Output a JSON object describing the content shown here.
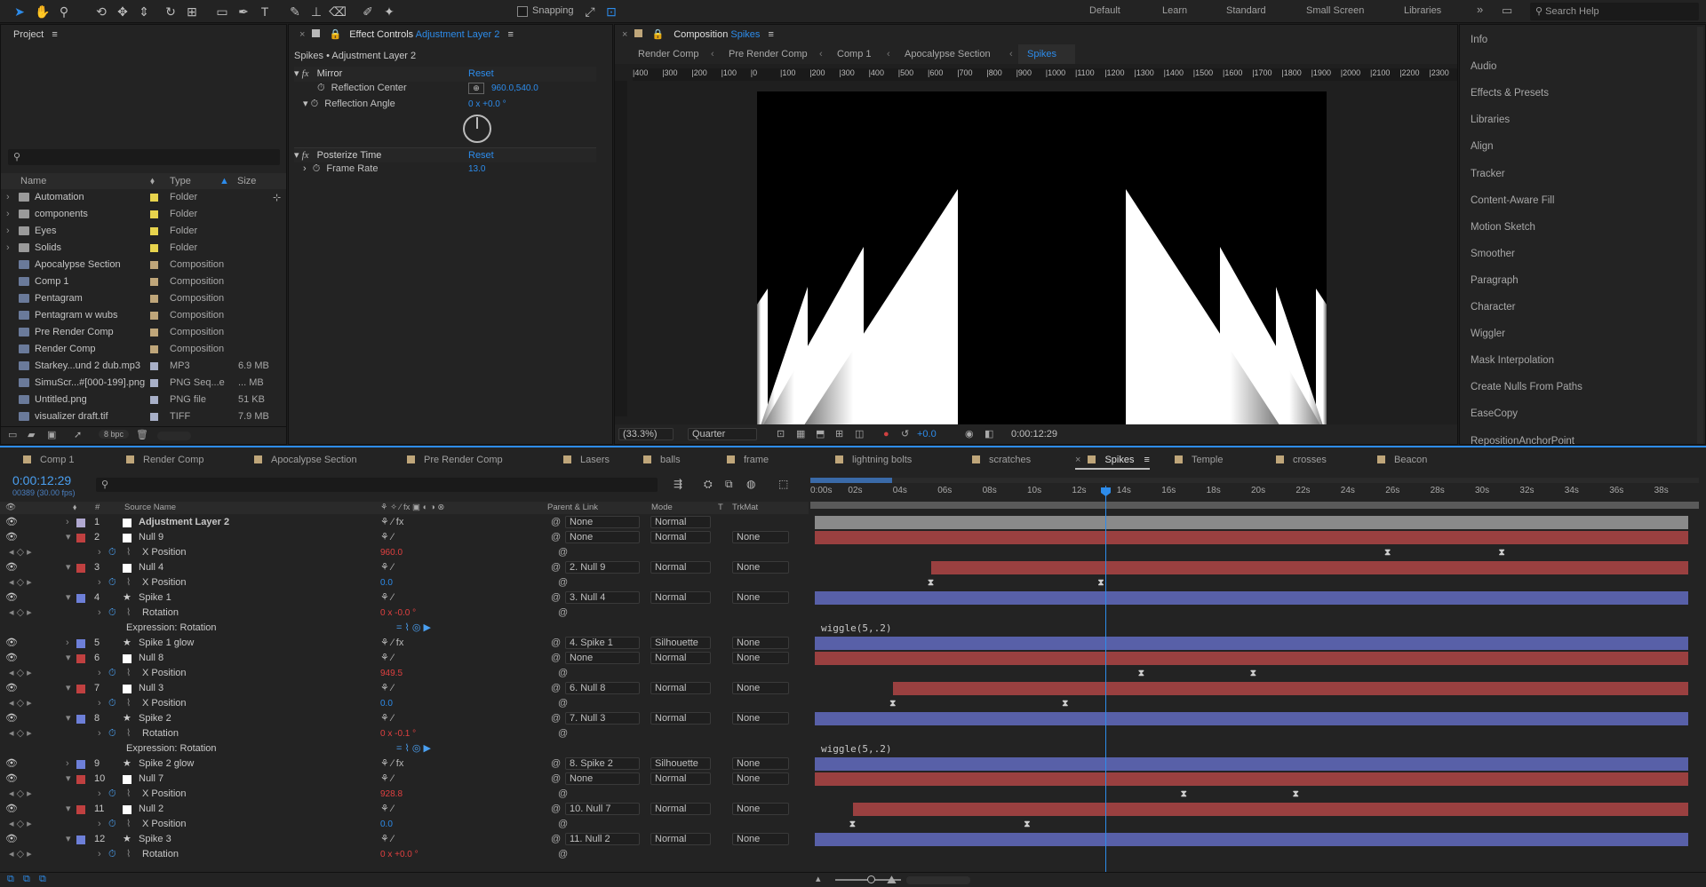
{
  "toolbar": {
    "snapping": "Snapping",
    "workspaces": [
      "Default",
      "Learn",
      "Standard",
      "Small Screen",
      "Libraries"
    ],
    "search_placeholder": "Search Help"
  },
  "project": {
    "title": "Project",
    "columns": {
      "name": "Name",
      "type": "Type",
      "size": "Size"
    },
    "items": [
      {
        "name": "Automation",
        "type": "Folder",
        "size": "",
        "color": "#e8d44d"
      },
      {
        "name": "components",
        "type": "Folder",
        "size": "",
        "color": "#e8d44d"
      },
      {
        "name": "Eyes",
        "type": "Folder",
        "size": "",
        "color": "#e8d44d"
      },
      {
        "name": "Solids",
        "type": "Folder",
        "size": "",
        "color": "#e8d44d"
      },
      {
        "name": "Apocalypse Section",
        "type": "Composition",
        "size": "",
        "color": "#bfa67a"
      },
      {
        "name": "Comp 1",
        "type": "Composition",
        "size": "",
        "color": "#bfa67a"
      },
      {
        "name": "Pentagram",
        "type": "Composition",
        "size": "",
        "color": "#bfa67a"
      },
      {
        "name": "Pentagram w wubs",
        "type": "Composition",
        "size": "",
        "color": "#bfa67a"
      },
      {
        "name": "Pre Render Comp",
        "type": "Composition",
        "size": "",
        "color": "#bfa67a"
      },
      {
        "name": "Render Comp",
        "type": "Composition",
        "size": "",
        "color": "#bfa67a"
      },
      {
        "name": "Starkey...und 2 dub.mp3",
        "type": "MP3",
        "size": "6.9 MB",
        "color": "#a8b0c8"
      },
      {
        "name": "SimuScr...#[000-199].png",
        "type": "PNG Seq...e",
        "size": "... MB",
        "color": "#a8b0c8"
      },
      {
        "name": "Untitled.png",
        "type": "PNG file",
        "size": "51 KB",
        "color": "#a8b0c8"
      },
      {
        "name": "visualizer draft.tif",
        "type": "TIFF",
        "size": "7.9 MB",
        "color": "#a8b0c8"
      }
    ],
    "bpc": "8 bpc"
  },
  "effect_controls": {
    "title": "Effect Controls",
    "layer": "Adjustment Layer 2",
    "breadcrumb": "Spikes • Adjustment Layer 2",
    "mirror": {
      "name": "Mirror",
      "reset": "Reset",
      "center_label": "Reflection Center",
      "center_value": "960.0,540.0",
      "angle_label": "Reflection Angle",
      "angle_value": "0 x +0.0 °"
    },
    "posterize": {
      "name": "Posterize Time",
      "reset": "Reset",
      "rate_label": "Frame Rate",
      "rate_value": "13.0"
    }
  },
  "composition": {
    "title": "Composition",
    "name": "Spikes",
    "breadcrumbs": [
      "Render Comp",
      "Pre Render Comp",
      "Comp 1",
      "Apocalypse Section",
      "Spikes"
    ],
    "zoom": "(33.3%)",
    "resolution": "Quarter",
    "exposure": "+0.0",
    "timecode": "0:00:12:29",
    "ruler": [
      "|400",
      "|300",
      "|200",
      "|100",
      "|0",
      "|100",
      "|200",
      "|300",
      "|400",
      "|500",
      "|600",
      "|700",
      "|800",
      "|900",
      "|1000",
      "|1100",
      "|1200",
      "|1300",
      "|1400",
      "|1500",
      "|1600",
      "|1700",
      "|1800",
      "|1900",
      "|2000",
      "|2100",
      "|2200",
      "|2300"
    ]
  },
  "right_panel": [
    "Info",
    "Audio",
    "Effects & Presets",
    "Libraries",
    "Align",
    "Tracker",
    "Content-Aware Fill",
    "Motion Sketch",
    "Smoother",
    "Paragraph",
    "Character",
    "Wiggler",
    "Mask Interpolation",
    "Create Nulls From Paths",
    "EaseCopy",
    "RepositionAnchorPoint"
  ],
  "timeline": {
    "tabs": [
      "Comp 1",
      "Render Comp",
      "Apocalypse Section",
      "Pre Render Comp",
      "Lasers",
      "balls",
      "frame",
      "lightning bolts",
      "scratches",
      "Spikes",
      "Temple",
      "crosses",
      "Beacon"
    ],
    "active_tab": "Spikes",
    "timecode": "0:00:12:29",
    "frame_info": "00389 (30.00 fps)",
    "col_headers": {
      "num": "#",
      "source": "Source Name",
      "parent": "Parent & Link",
      "mode": "Mode",
      "t": "T",
      "trkmat": "TrkMat"
    },
    "ruler": [
      "0:00s",
      "02s",
      "04s",
      "06s",
      "08s",
      "10s",
      "12s",
      "14s",
      "16s",
      "18s",
      "20s",
      "22s",
      "24s",
      "26s",
      "28s",
      "30s",
      "32s",
      "34s",
      "36s",
      "38s"
    ],
    "rows": [
      {
        "kind": "layer",
        "num": "1",
        "name": "Adjustment Layer 2",
        "color": "#b0a8d0",
        "parent": "None",
        "mode": "Normal",
        "trkmat": "",
        "bar": "#8a8a8a",
        "bold": true
      },
      {
        "kind": "layer",
        "num": "2",
        "name": "Null 9",
        "color": "#c04040",
        "parent": "None",
        "mode": "Normal",
        "trkmat": "None",
        "bar": "#9a4040"
      },
      {
        "kind": "prop",
        "name": "X Position",
        "value": "960.0",
        "valcolor": "red",
        "kfs": [
          25.6,
          30.7
        ]
      },
      {
        "kind": "layer",
        "num": "3",
        "name": "Null 4",
        "color": "#c04040",
        "parent": "2. Null 9",
        "mode": "Normal",
        "trkmat": "None",
        "bar": "#9a4040",
        "barstart": 5.2
      },
      {
        "kind": "prop",
        "name": "X Position",
        "value": "0.0",
        "valcolor": "blue",
        "kfs": [
          5.2,
          12.8
        ]
      },
      {
        "kind": "layer",
        "num": "4",
        "name": "Spike 1",
        "color": "#6d7fd8",
        "parent": "3. Null 4",
        "mode": "Normal",
        "trkmat": "None",
        "bar": "#5860a8",
        "star": true
      },
      {
        "kind": "prop",
        "name": "Rotation",
        "value": "0 x -0.0 °",
        "valcolor": "red",
        "kfs": []
      },
      {
        "kind": "expr",
        "name": "Expression: Rotation",
        "expr": "wiggle(5,.2)"
      },
      {
        "kind": "layer",
        "num": "5",
        "name": "Spike 1 glow",
        "color": "#6d7fd8",
        "parent": "4. Spike 1",
        "mode": "Silhouette",
        "trkmat": "None",
        "bar": "#5860a8",
        "star": true
      },
      {
        "kind": "layer",
        "num": "6",
        "name": "Null 8",
        "color": "#c04040",
        "parent": "None",
        "mode": "Normal",
        "trkmat": "None",
        "bar": "#9a4040"
      },
      {
        "kind": "prop",
        "name": "X Position",
        "value": "949.5",
        "valcolor": "red",
        "kfs": [
          14.6,
          19.6
        ]
      },
      {
        "kind": "layer",
        "num": "7",
        "name": "Null 3",
        "color": "#c04040",
        "parent": "6. Null 8",
        "mode": "Normal",
        "trkmat": "None",
        "bar": "#9a4040",
        "barstart": 3.5
      },
      {
        "kind": "prop",
        "name": "X Position",
        "value": "0.0",
        "valcolor": "blue",
        "kfs": [
          3.5,
          11.2
        ]
      },
      {
        "kind": "layer",
        "num": "8",
        "name": "Spike 2",
        "color": "#6d7fd8",
        "parent": "7. Null 3",
        "mode": "Normal",
        "trkmat": "None",
        "bar": "#5860a8",
        "star": true
      },
      {
        "kind": "prop",
        "name": "Rotation",
        "value": "0 x -0.1 °",
        "valcolor": "red",
        "kfs": []
      },
      {
        "kind": "expr",
        "name": "Expression: Rotation",
        "expr": "wiggle(5,.2)"
      },
      {
        "kind": "layer",
        "num": "9",
        "name": "Spike 2 glow",
        "color": "#6d7fd8",
        "parent": "8. Spike 2",
        "mode": "Silhouette",
        "trkmat": "None",
        "bar": "#5860a8",
        "star": true
      },
      {
        "kind": "layer",
        "num": "10",
        "name": "Null 7",
        "color": "#c04040",
        "parent": "None",
        "mode": "Normal",
        "trkmat": "None",
        "bar": "#9a4040"
      },
      {
        "kind": "prop",
        "name": "X Position",
        "value": "928.8",
        "valcolor": "red",
        "kfs": [
          16.5,
          21.5
        ]
      },
      {
        "kind": "layer",
        "num": "11",
        "name": "Null 2",
        "color": "#c04040",
        "parent": "10. Null 7",
        "mode": "Normal",
        "trkmat": "None",
        "bar": "#9a4040",
        "barstart": 1.7
      },
      {
        "kind": "prop",
        "name": "X Position",
        "value": "0.0",
        "valcolor": "blue",
        "kfs": [
          1.7,
          9.5
        ]
      },
      {
        "kind": "layer",
        "num": "12",
        "name": "Spike 3",
        "color": "#6d7fd8",
        "parent": "11. Null 2",
        "mode": "Normal",
        "trkmat": "None",
        "bar": "#5860a8",
        "star": true
      },
      {
        "kind": "prop",
        "name": "Rotation",
        "value": "0 x +0.0 °",
        "valcolor": "red",
        "kfs": []
      }
    ]
  }
}
